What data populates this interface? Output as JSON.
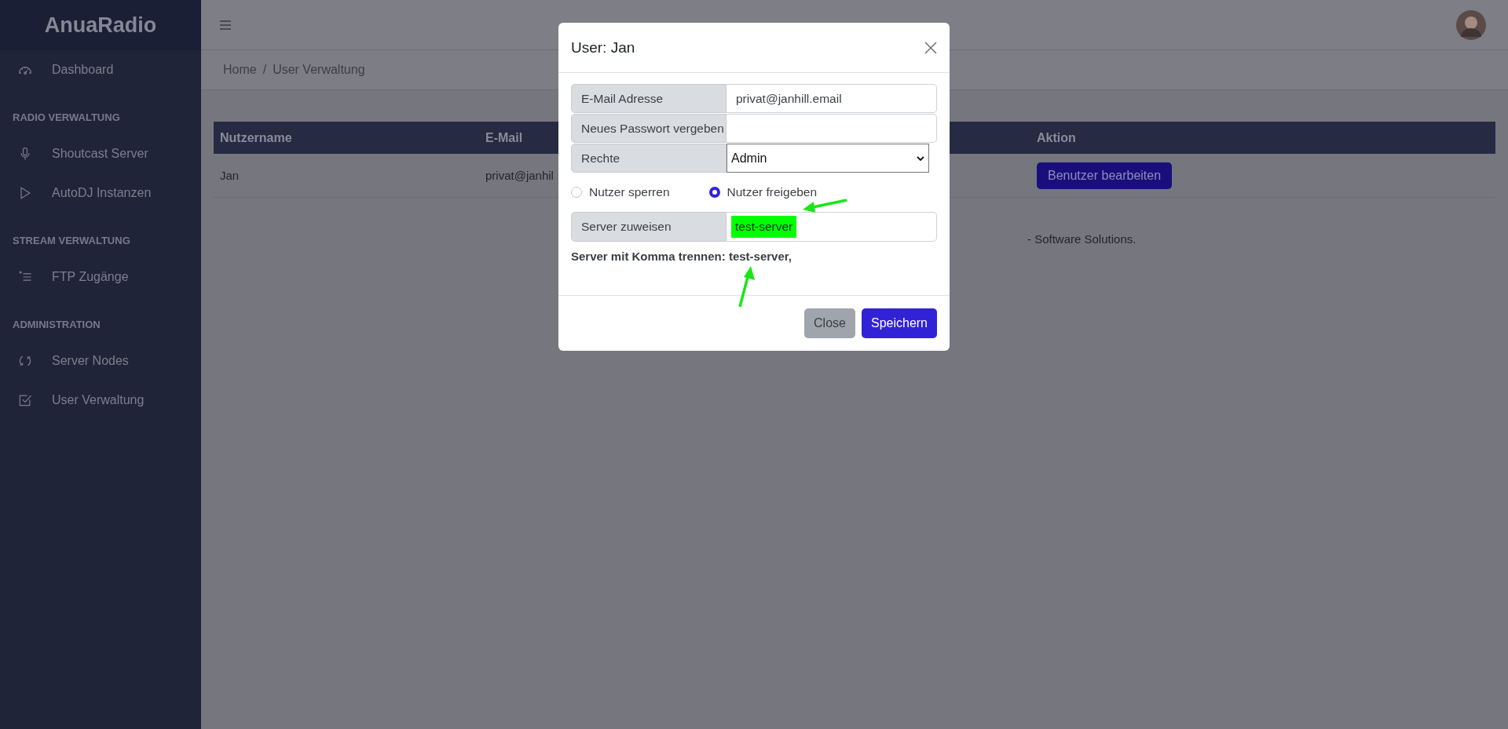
{
  "sidebar": {
    "logo": "AnuaRadio",
    "items": [
      {
        "kind": "link",
        "label": "Dashboard"
      },
      {
        "kind": "heading",
        "label": "RADIO VERWALTUNG"
      },
      {
        "kind": "link",
        "label": "Shoutcast Server"
      },
      {
        "kind": "link",
        "label": "AutoDJ Instanzen"
      },
      {
        "kind": "heading",
        "label": "STREAM VERWALTUNG"
      },
      {
        "kind": "link",
        "label": "FTP Zugänge"
      },
      {
        "kind": "heading",
        "label": "ADMINISTRATION"
      },
      {
        "kind": "link",
        "label": "Server Nodes"
      },
      {
        "kind": "link",
        "label": "User Verwaltung"
      }
    ]
  },
  "breadcrumb": {
    "items": [
      "Home",
      "User Verwaltung"
    ],
    "separator": "/"
  },
  "table": {
    "columns": [
      "Nutzername",
      "E-Mail",
      "Aktion"
    ],
    "rows": [
      {
        "cells": [
          "Jan",
          "privat@janhil"
        ],
        "action": "Benutzer bearbeiten"
      }
    ]
  },
  "footer": "- Software Solutions.",
  "modal": {
    "title": "User: Jan",
    "fields": [
      {
        "kind": "text",
        "label": "E-Mail Adresse",
        "value": "privat@janhill.email"
      },
      {
        "kind": "text",
        "label": "Neues Passwort vergeben"
      },
      {
        "kind": "select",
        "label": "Rechte",
        "value": "Admin"
      }
    ],
    "radios": [
      {
        "label": "Nutzer sperren",
        "selected": false
      },
      {
        "label": "Nutzer freigeben",
        "selected": true
      }
    ],
    "server": {
      "label": "Server zuweisen",
      "value": "test-server",
      "highlighted": true
    },
    "help": "Server mit Komma trennen: test-server,",
    "buttons": [
      {
        "kind": "secondary",
        "label": "Close"
      },
      {
        "kind": "primary",
        "label": "Speichern"
      }
    ]
  }
}
